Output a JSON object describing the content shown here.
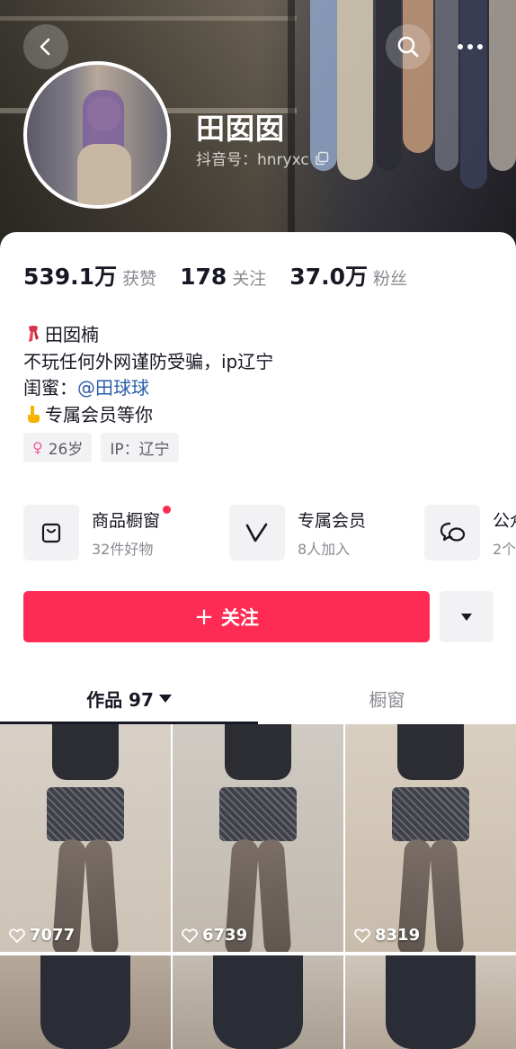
{
  "header": {
    "display_name": "田囡囡",
    "douyin_id_label": "抖音号：hnryxc",
    "icons": [
      "back-icon",
      "search-icon",
      "more-icon",
      "copy-icon"
    ]
  },
  "stats": [
    {
      "value": "539.1万",
      "label": "获赞"
    },
    {
      "value": "178",
      "label": "关注"
    },
    {
      "value": "37.0万",
      "label": "粉丝"
    }
  ],
  "bio": {
    "line1": "田囡楠",
    "line2": "不玩任何外网谨防受骗，ip辽宁",
    "line3_prefix": "闺蜜：",
    "line3_mention": "@田球球",
    "line4": "专属会员等你"
  },
  "tags": {
    "age": "26岁",
    "ip": "IP：辽宁"
  },
  "services": [
    {
      "title": "商品橱窗",
      "subtitle": "32件好物",
      "icon": "shop-bag-icon"
    },
    {
      "title": "专属会员",
      "subtitle": "8人加入",
      "icon": "vip-v-icon"
    },
    {
      "title": "公众",
      "subtitle": "2个",
      "icon": "chat-bubbles-icon"
    }
  ],
  "actions": {
    "follow_label": "关注",
    "dropdown_icon": "caret-down-icon"
  },
  "tabs": {
    "works_label": "作品 97",
    "window_label": "橱窗"
  },
  "videos": [
    {
      "likes": "7077"
    },
    {
      "likes": "6739"
    },
    {
      "likes": "8319"
    },
    {
      "likes": ""
    },
    {
      "likes": ""
    },
    {
      "likes": ""
    }
  ],
  "colors": {
    "accent": "#fe2c55",
    "mention": "#2b5ea8",
    "gender_female": "#ef5ba1"
  }
}
